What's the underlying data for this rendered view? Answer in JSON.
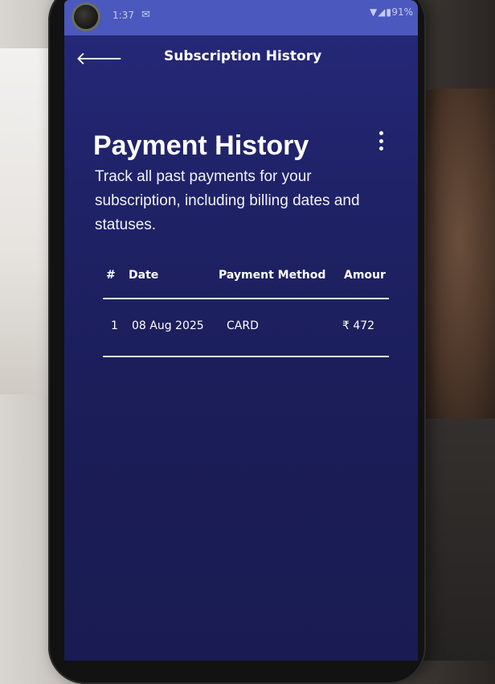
{
  "status_bar": {
    "time": "1:37",
    "notification_icon": "gmail-icon",
    "signal_icons": "wifi-icon signal-icon battery-icon",
    "battery": "91%"
  },
  "app_bar": {
    "back_icon": "arrow-left-icon",
    "title": "Subscription History"
  },
  "header": {
    "title": "Payment History",
    "description": "Track all past payments for your subscription, including billing dates and statuses.",
    "menu_icon": "more-vertical-icon"
  },
  "table": {
    "columns": [
      "#",
      "Date",
      "Payment Method",
      "Amour"
    ],
    "rows": [
      {
        "num": "1",
        "date": "08 Aug 2025",
        "method": "CARD",
        "amount": "₹ 472"
      }
    ]
  },
  "colors": {
    "screen_bg": "#1f2266",
    "status_bar": "#4b58bd",
    "text": "#ffffff"
  }
}
